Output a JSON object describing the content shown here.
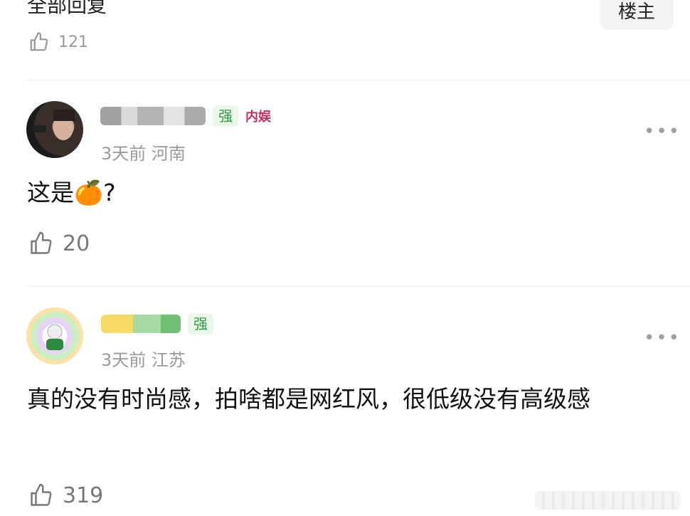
{
  "header": {
    "title": "全部回复",
    "filter_label": "楼主"
  },
  "previous": {
    "likes": "121"
  },
  "comments": [
    {
      "badge": "强",
      "vip": "内娱",
      "time": "3天前",
      "region": "河南",
      "text": "这是🍊?",
      "likes": "20"
    },
    {
      "badge": "强",
      "time": "3天前",
      "region": "江苏",
      "text": "真的没有时尚感，拍啥都是网红风，很低级没有高级感",
      "likes": "319"
    }
  ],
  "more_glyph": "•••"
}
